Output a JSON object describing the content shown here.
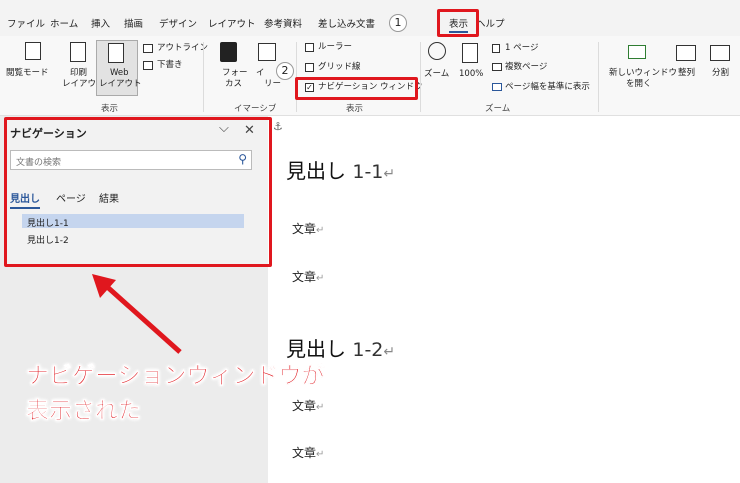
{
  "menu": {
    "items": [
      "ファイル",
      "ホーム",
      "挿入",
      "描画",
      "デザイン",
      "レイアウト",
      "参考資料",
      "差し込み文書",
      "表示",
      "ヘルプ"
    ]
  },
  "ribbon": {
    "views": {
      "read_mode": "閲覧モード",
      "print_layout_1": "印刷",
      "print_layout_2": "レイアウト",
      "web_layout_1": "Web",
      "web_layout_2": "レイアウト",
      "outline": "アウトライン",
      "draft": "下書き",
      "group": "表示"
    },
    "immersive": {
      "focus_1": "フォー",
      "focus_2": "カス",
      "reader_1": "イ",
      "reader_2": "リー",
      "group": "イマーシブ"
    },
    "show": {
      "ruler": "ルーラー",
      "gridlines": "グリッド線",
      "nav_pane": "ナビゲーション ウィンドウ",
      "group": "表示"
    },
    "zoom": {
      "zoom": "ズーム",
      "percent": "100%",
      "one_page": "1 ページ",
      "multi_page": "複数ページ",
      "page_width": "ページ幅を基準に表示",
      "group": "ズーム"
    },
    "window": {
      "new_window_1": "新しいウィンドウ",
      "new_window_2": "を開く",
      "arrange": "整列",
      "split": "分割"
    }
  },
  "nav_pane": {
    "title": "ナビゲーション",
    "search_placeholder": "文書の検索",
    "tabs": [
      "見出し",
      "ページ",
      "結果"
    ],
    "headings": [
      "見出し1-1",
      "見出し1-2"
    ]
  },
  "document": {
    "heading1_text": "見出し",
    "heading1_num": "1-1",
    "heading2_text": "見出し",
    "heading2_num": "1-2",
    "body": "文章",
    "para_mark": "↵"
  },
  "annotations": {
    "step1": "1",
    "step2": "2",
    "callout_line1": "ナビゲーションウィンドウが",
    "callout_line2": "表示された"
  },
  "colors": {
    "annotation_red": "#e0171e",
    "accent_blue": "#2b579a",
    "selected_heading_bg": "#c5d5ee"
  }
}
